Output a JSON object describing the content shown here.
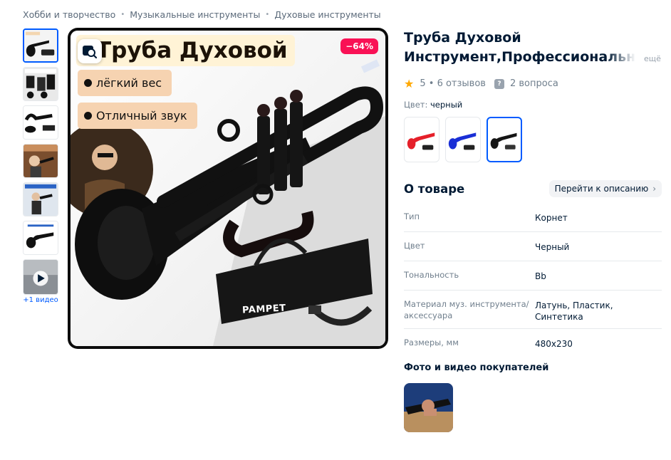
{
  "breadcrumbs": [
    {
      "label": "Хобби и творчество"
    },
    {
      "label": "Музыкальные инструменты"
    },
    {
      "label": "Духовые инструменты"
    }
  ],
  "gallery": {
    "video_caption": "+1 видео",
    "thumbnail_count": 7
  },
  "main_image": {
    "promo_title": "Труба Духовой",
    "features": [
      "лёгкий вес",
      "Отличный звук"
    ],
    "discount": "−64%",
    "brand_on_case": "PAMPET"
  },
  "product": {
    "title_line1": "Труба Духовой",
    "title_line2": "Инструмент,Профессиональная",
    "more_label": "ещё",
    "rating": "5",
    "reviews": "6 отзывов",
    "rating_separator": "•",
    "questions": "2 вопроса",
    "color_label": "Цвет:",
    "color_value": "черный",
    "color_variants": [
      {
        "color": "#e5202a"
      },
      {
        "color": "#1a2fd6"
      },
      {
        "color": "#151515"
      }
    ]
  },
  "about": {
    "title": "О товаре",
    "goto_label": "Перейти к описанию",
    "specs": [
      {
        "key": "Тип",
        "value": "Корнет"
      },
      {
        "key": "Цвет",
        "value": "Черный"
      },
      {
        "key": "Тональность",
        "value": "Bb"
      },
      {
        "key": "Материал муз. инструмента/ аксессуара",
        "value": "Латунь, Пластик, Синтетика"
      },
      {
        "key": "Размеры, мм",
        "value": "480x230"
      }
    ]
  },
  "customer_photos": {
    "title": "Фото и видео покупателей"
  },
  "colors": {
    "accent": "#005bff",
    "discount": "#f91155",
    "star": "#ffa800"
  }
}
